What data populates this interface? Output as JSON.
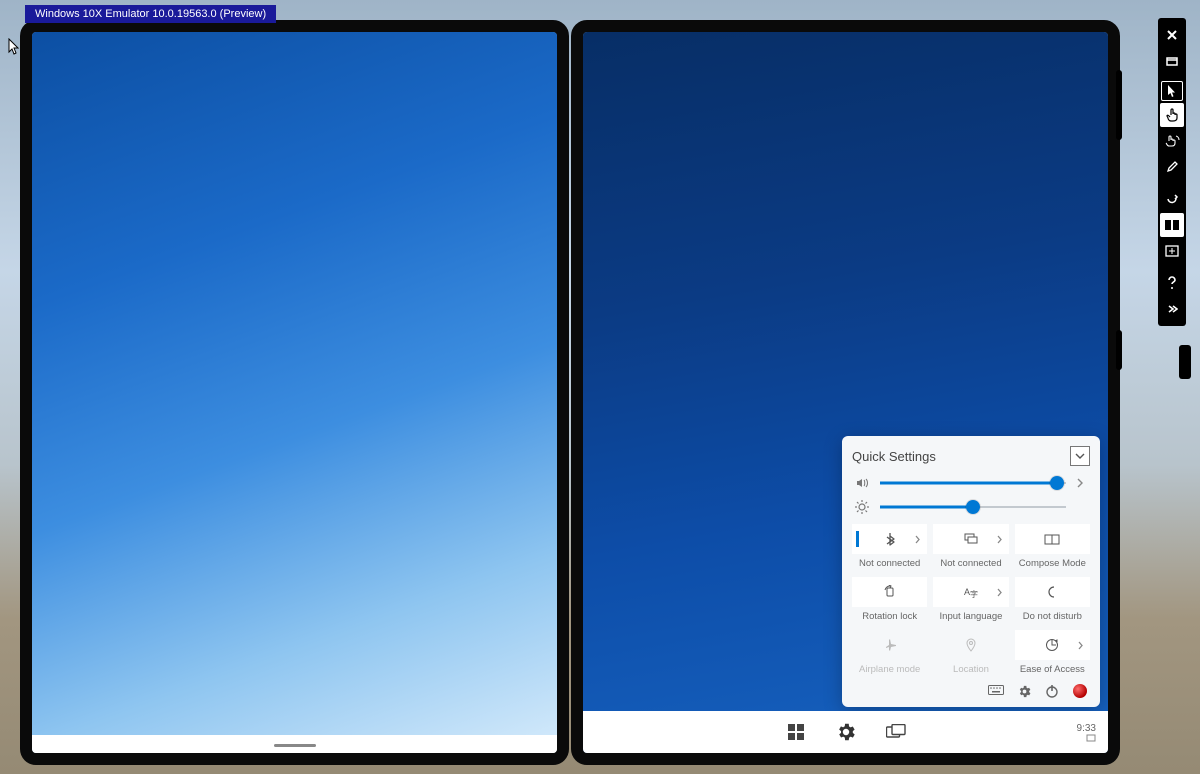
{
  "title": "Windows 10X Emulator 10.0.19563.0 (Preview)",
  "quick_settings": {
    "title": "Quick Settings",
    "volume_percent": 95,
    "brightness_percent": 50,
    "tiles": [
      {
        "key": "bluetooth",
        "label": "Not connected",
        "icon": "bluetooth-icon",
        "accent": true,
        "chevron": true,
        "disabled": false
      },
      {
        "key": "wifi",
        "label": "Not connected",
        "icon": "network-icon",
        "accent": false,
        "chevron": true,
        "disabled": false
      },
      {
        "key": "compose",
        "label": "Compose Mode",
        "icon": "compose-icon",
        "accent": false,
        "chevron": false,
        "disabled": false
      },
      {
        "key": "rotation",
        "label": "Rotation lock",
        "icon": "rotation-icon",
        "accent": false,
        "chevron": false,
        "disabled": false
      },
      {
        "key": "input_lang",
        "label": "Input language",
        "icon": "language-icon",
        "accent": false,
        "chevron": true,
        "disabled": false
      },
      {
        "key": "dnd",
        "label": "Do not disturb",
        "icon": "moon-icon",
        "accent": false,
        "chevron": false,
        "disabled": false
      },
      {
        "key": "airplane",
        "label": "Airplane mode",
        "icon": "airplane-icon",
        "accent": false,
        "chevron": false,
        "disabled": true
      },
      {
        "key": "location",
        "label": "Location",
        "icon": "location-icon",
        "accent": false,
        "chevron": false,
        "disabled": true
      },
      {
        "key": "ease",
        "label": "Ease of Access",
        "icon": "ease-icon",
        "accent": false,
        "chevron": true,
        "disabled": false
      }
    ],
    "footer_icons": [
      "keyboard-icon",
      "gear-icon",
      "power-icon",
      "record-icon"
    ]
  },
  "taskbar": {
    "icons": [
      "start-icon",
      "gear-icon",
      "task-view-icon"
    ],
    "time": "9:33"
  },
  "emulator_toolbar": [
    {
      "key": "close",
      "icon": "close-icon"
    },
    {
      "key": "minimize",
      "icon": "minimize-icon"
    },
    {
      "key": "sep"
    },
    {
      "key": "pointer",
      "icon": "pointer-icon",
      "selected": false,
      "outlined": true
    },
    {
      "key": "single-touch",
      "icon": "hand-point-icon",
      "selected": true
    },
    {
      "key": "multi-touch",
      "icon": "hand-multi-icon"
    },
    {
      "key": "pen",
      "icon": "pen-icon"
    },
    {
      "key": "sep"
    },
    {
      "key": "rotate",
      "icon": "rotate-icon"
    },
    {
      "key": "span",
      "icon": "span-icon",
      "selected": true
    },
    {
      "key": "fit",
      "icon": "fit-icon"
    },
    {
      "key": "sep"
    },
    {
      "key": "help",
      "icon": "help-icon"
    },
    {
      "key": "more",
      "icon": "more-icon"
    }
  ],
  "colors": {
    "accent": "#0078d4"
  }
}
